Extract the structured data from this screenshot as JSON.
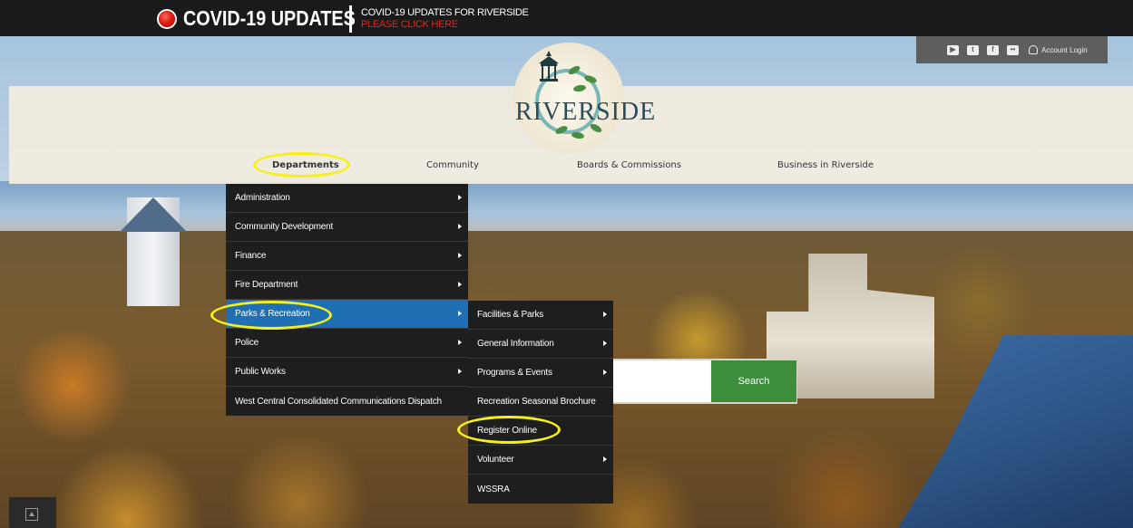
{
  "covid": {
    "title": "COVID-19 UPDATES",
    "line1": "COVID-19 UPDATES FOR RIVERSIDE",
    "line2": "PLEASE CLICK HERE"
  },
  "account": {
    "social_icons": [
      "youtube-icon",
      "twitter-icon",
      "facebook-icon",
      "flickr-icon"
    ],
    "login_label": "Account Login"
  },
  "logo": {
    "text": "RIVERSIDE"
  },
  "nav": {
    "departments": "Departments",
    "community": "Community",
    "boards": "Boards & Commissions",
    "business": "Business in Riverside"
  },
  "departments_menu": [
    {
      "label": "Administration",
      "has_sub": true
    },
    {
      "label": "Community Development",
      "has_sub": true
    },
    {
      "label": "Finance",
      "has_sub": true
    },
    {
      "label": "Fire Department",
      "has_sub": true
    },
    {
      "label": "Parks & Recreation",
      "has_sub": true,
      "active": true
    },
    {
      "label": "Police",
      "has_sub": true
    },
    {
      "label": "Public Works",
      "has_sub": true
    },
    {
      "label": "West Central Consolidated Communications Dispatch",
      "has_sub": false
    }
  ],
  "parks_submenu": [
    {
      "label": "Facilities & Parks",
      "has_sub": true
    },
    {
      "label": "General Information",
      "has_sub": true
    },
    {
      "label": "Programs & Events",
      "has_sub": true
    },
    {
      "label": "Recreation Seasonal Brochure",
      "has_sub": false
    },
    {
      "label": "Register Online",
      "has_sub": false
    },
    {
      "label": "Volunteer",
      "has_sub": true
    },
    {
      "label": "WSSRA",
      "has_sub": false
    }
  ],
  "search": {
    "button_label": "Search",
    "value": ""
  },
  "colors": {
    "topbar": "#1a1a1a",
    "menu_bg": "#1e1e1e",
    "menu_active": "#1f6fb4",
    "search_button": "#3d8e3b",
    "highlight": "#f6ef1a",
    "covid_red": "#e0261c"
  }
}
